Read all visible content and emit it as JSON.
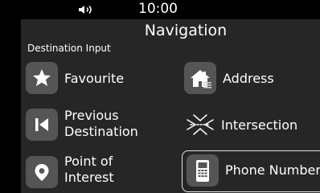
{
  "status": {
    "time": "10:00"
  },
  "header": {
    "title": "Navigation",
    "subtitle": "Destination Input"
  },
  "menu": {
    "favourite": "Favourite",
    "address": "Address",
    "previous_line1": "Previous",
    "previous_line2": "Destination",
    "intersection": "Intersection",
    "poi_line1": "Point of",
    "poi_line2": "Interest",
    "phone_number": "Phone Number"
  },
  "icons": {
    "volume": "speaker-icon",
    "favourite": "star-icon",
    "address": "house-icon",
    "previous": "skip-back-icon",
    "intersection": "intersection-icon",
    "poi": "map-pin-icon",
    "phone": "phone-icon"
  },
  "colors": {
    "background": "#000000",
    "panel": "#262626",
    "tile": "#555555",
    "text": "#ffffff"
  }
}
